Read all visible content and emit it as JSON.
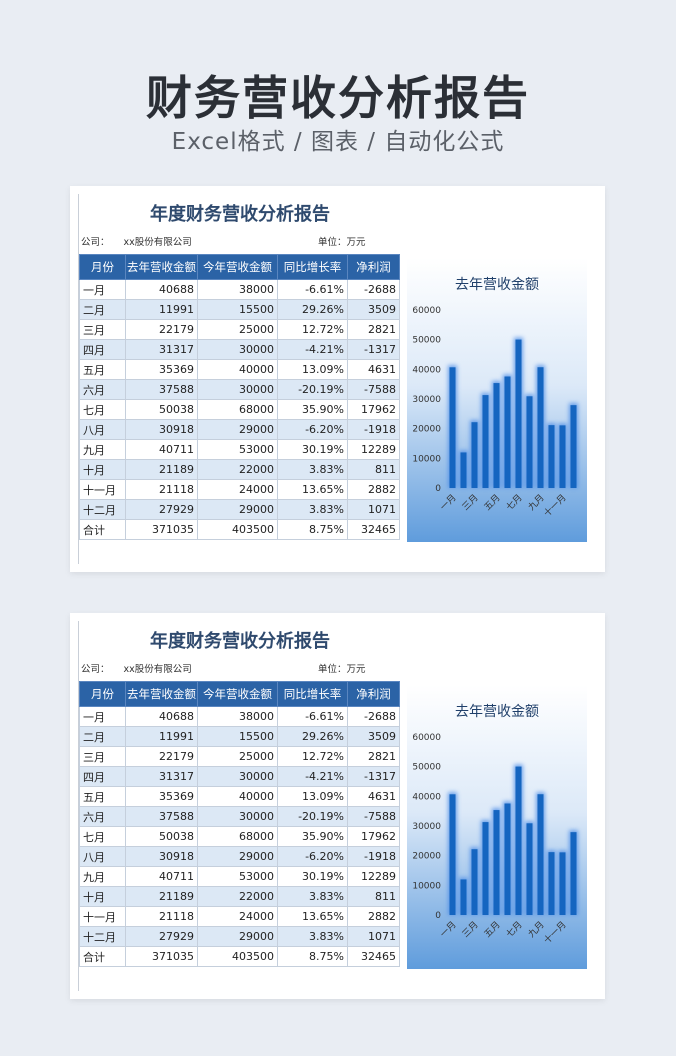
{
  "hero": {
    "title": "财务营收分析报告",
    "subtitle": "Excel格式 / 图表 / 自动化公式"
  },
  "sheet": {
    "title": "年度财务营收分析报告",
    "company_label": "公司：",
    "company_value": "xx股份有限公司",
    "unit_label": "单位：",
    "unit_value": "万元",
    "columns": [
      "月份",
      "去年营收金额",
      "今年营收金额",
      "同比增长率",
      "净利润"
    ],
    "rows": [
      [
        "一月",
        "40688",
        "38000",
        "-6.61%",
        "-2688"
      ],
      [
        "二月",
        "11991",
        "15500",
        "29.26%",
        "3509"
      ],
      [
        "三月",
        "22179",
        "25000",
        "12.72%",
        "2821"
      ],
      [
        "四月",
        "31317",
        "30000",
        "-4.21%",
        "-1317"
      ],
      [
        "五月",
        "35369",
        "40000",
        "13.09%",
        "4631"
      ],
      [
        "六月",
        "37588",
        "30000",
        "-20.19%",
        "-7588"
      ],
      [
        "七月",
        "50038",
        "68000",
        "35.90%",
        "17962"
      ],
      [
        "八月",
        "30918",
        "29000",
        "-6.20%",
        "-1918"
      ],
      [
        "九月",
        "40711",
        "53000",
        "30.19%",
        "12289"
      ],
      [
        "十月",
        "21189",
        "22000",
        "3.83%",
        "811"
      ],
      [
        "十一月",
        "21118",
        "24000",
        "13.65%",
        "2882"
      ],
      [
        "十二月",
        "27929",
        "29000",
        "3.83%",
        "1071"
      ],
      [
        "合计",
        "371035",
        "403500",
        "8.75%",
        "32465"
      ]
    ]
  },
  "colors": {
    "header_bg": "#2b63a6",
    "alt_row": "#dce8f5",
    "bar": "#1565c0",
    "title": "#2f4a6e"
  },
  "chart_data": {
    "type": "bar",
    "title": "去年营收金额",
    "categories": [
      "一月",
      "二月",
      "三月",
      "四月",
      "五月",
      "六月",
      "七月",
      "八月",
      "九月",
      "十月",
      "十一月",
      "十二月"
    ],
    "values": [
      40688,
      11991,
      22179,
      31317,
      35369,
      37588,
      50038,
      30918,
      40711,
      21189,
      21118,
      27929
    ],
    "ylim": [
      0,
      60000
    ],
    "yticks": [
      "0",
      "10000",
      "20000",
      "30000",
      "40000",
      "50000",
      "60000"
    ],
    "xtick_labels": [
      "一月",
      "三月",
      "五月",
      "七月",
      "九月",
      "十一月"
    ],
    "grid": false,
    "legend": "none"
  }
}
